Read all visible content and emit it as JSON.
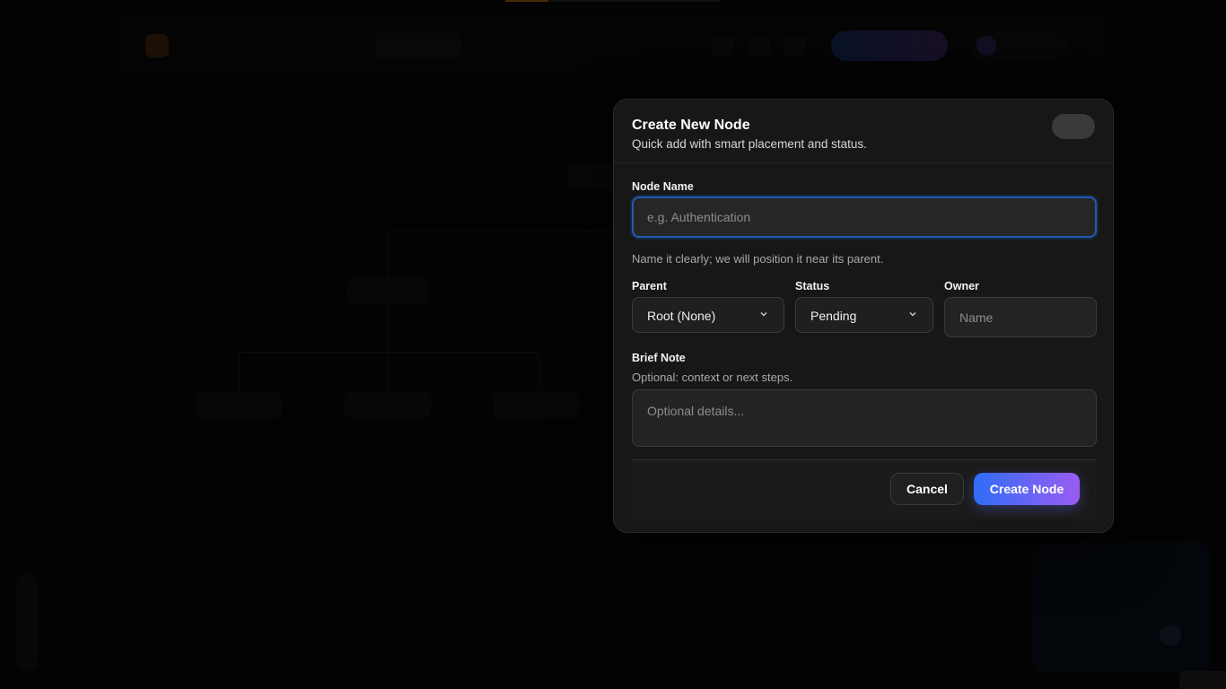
{
  "modal": {
    "title": "Create New Node",
    "subtitle": "Quick add with smart placement and status.",
    "node_name": {
      "label": "Node Name",
      "value": "",
      "placeholder": "e.g. Authentication",
      "help": "Name it clearly; we will position it near its parent."
    },
    "parent": {
      "label": "Parent",
      "selected": "Root (None)"
    },
    "status": {
      "label": "Status",
      "selected": "Pending"
    },
    "owner": {
      "label": "Owner",
      "value": "",
      "placeholder": "Name"
    },
    "note": {
      "label": "Brief Note",
      "help": "Optional: context or next steps.",
      "value": "",
      "placeholder": "Optional details..."
    },
    "cancel_label": "Cancel",
    "create_label": "Create Node"
  },
  "background": {
    "progress": 0.2
  },
  "colors": {
    "accent_start": "#2f6df6",
    "accent_end": "#9b5cf2",
    "focus_ring": "#1e5bb3",
    "modal_bg": "#171717"
  },
  "icons": {
    "close": "close-icon",
    "select_chevron": "chevron-down-icon"
  }
}
